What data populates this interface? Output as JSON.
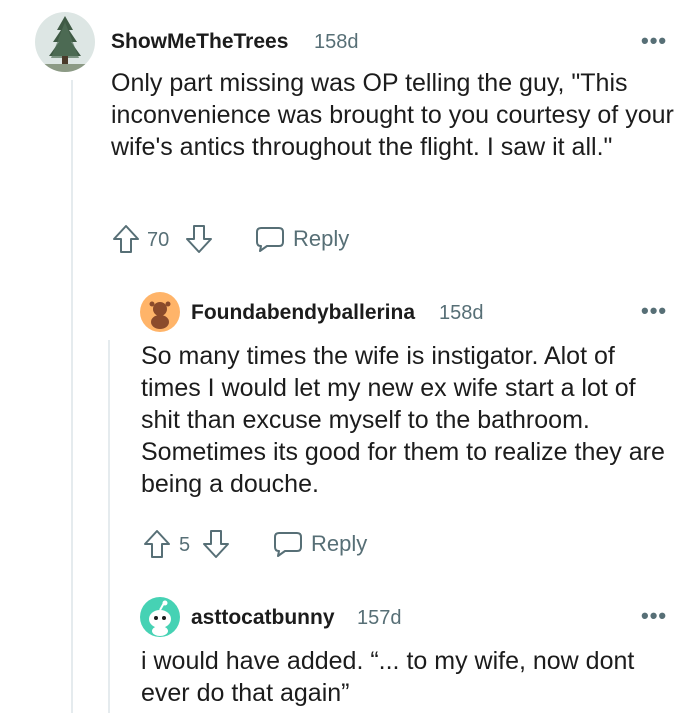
{
  "comments": [
    {
      "username": "ShowMeTheTrees",
      "age": "158d",
      "body": "Only part missing was OP telling the guy, \"This inconvenience was brought to you courtesy of your wife's antics throughout the flight. I saw it all.\"",
      "votes": "70",
      "reply_label": "Reply",
      "avatar_icon": "tree-avatar"
    },
    {
      "username": "Foundabendyballerina",
      "age": "158d",
      "body": "So many times the wife is instigator. Alot of times I would let my new ex wife start a lot of shit than excuse myself to the bathroom. Sometimes its good for them to realize they are being a douche.",
      "votes": "5",
      "reply_label": "Reply",
      "avatar_icon": "snoo-avatar-orange"
    },
    {
      "username": "asttocatbunny",
      "age": "157d",
      "body": "i would have added. “... to my wife, now dont ever do that again”",
      "avatar_icon": "snoo-avatar-teal"
    }
  ],
  "colors": {
    "meta_gray": "#576f76",
    "text": "#1c1c1c",
    "thread_line": "#e5ebee"
  }
}
